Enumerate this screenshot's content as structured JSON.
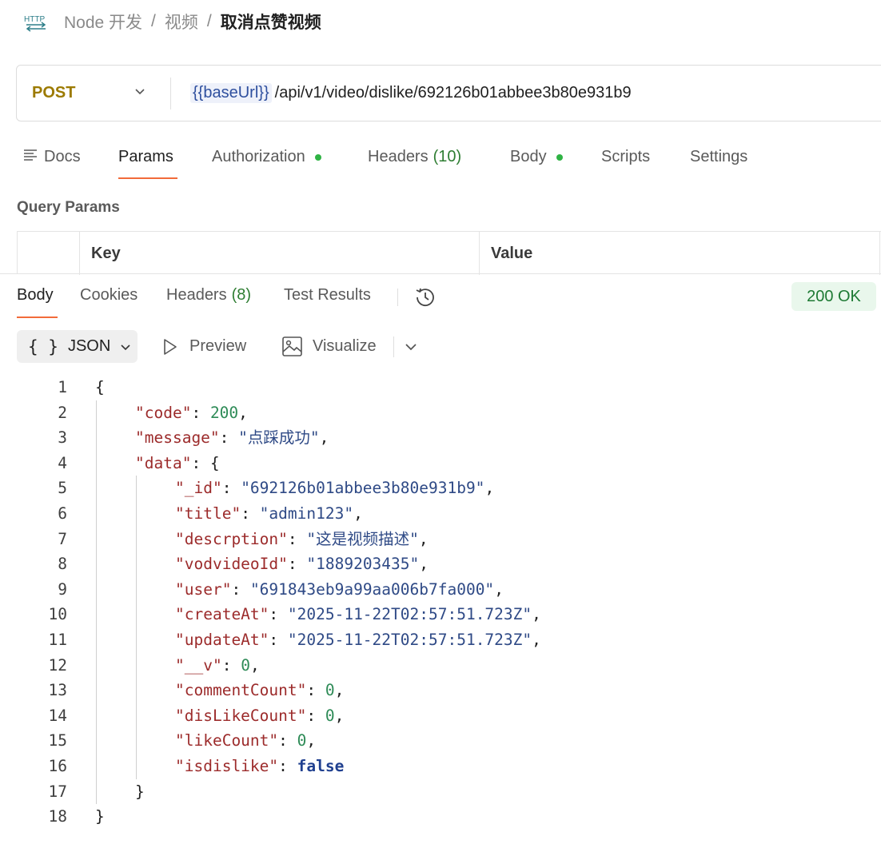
{
  "breadcrumb": {
    "icon": "http-icon",
    "icon_text": "HTTP",
    "items": [
      "Node 开发",
      "视频"
    ],
    "current": "取消点赞视频"
  },
  "request": {
    "method": "POST",
    "url_variable": "{{baseUrl}}",
    "url_path": "/api/v1/video/dislike/692126b01abbee3b80e931b9"
  },
  "request_tabs": {
    "docs": "Docs",
    "params": "Params",
    "authorization": "Authorization",
    "headers": "Headers",
    "headers_count": "(10)",
    "body": "Body",
    "scripts": "Scripts",
    "settings": "Settings"
  },
  "query_params": {
    "title": "Query Params",
    "columns": [
      "Key",
      "Value"
    ]
  },
  "response_tabs": {
    "body": "Body",
    "cookies": "Cookies",
    "headers": "Headers",
    "headers_count": "(8)",
    "test_results": "Test Results"
  },
  "status": "200 OK",
  "format": {
    "selected": "JSON",
    "preview": "Preview",
    "visualize": "Visualize"
  },
  "code_lines": [
    {
      "n": "1",
      "indent": 0,
      "parts": [
        [
          "p",
          "{"
        ]
      ]
    },
    {
      "n": "2",
      "indent": 1,
      "parts": [
        [
          "k",
          "\"code\""
        ],
        [
          "p",
          ": "
        ],
        [
          "n",
          "200"
        ],
        [
          "p",
          ","
        ]
      ]
    },
    {
      "n": "3",
      "indent": 1,
      "parts": [
        [
          "k",
          "\"message\""
        ],
        [
          "p",
          ": "
        ],
        [
          "s",
          "\"点踩成功\""
        ],
        [
          "p",
          ","
        ]
      ]
    },
    {
      "n": "4",
      "indent": 1,
      "parts": [
        [
          "k",
          "\"data\""
        ],
        [
          "p",
          ": {"
        ]
      ]
    },
    {
      "n": "5",
      "indent": 2,
      "parts": [
        [
          "k",
          "\"_id\""
        ],
        [
          "p",
          ": "
        ],
        [
          "s",
          "\"692126b01abbee3b80e931b9\""
        ],
        [
          "p",
          ","
        ]
      ]
    },
    {
      "n": "6",
      "indent": 2,
      "parts": [
        [
          "k",
          "\"title\""
        ],
        [
          "p",
          ": "
        ],
        [
          "s",
          "\"admin123\""
        ],
        [
          "p",
          ","
        ]
      ]
    },
    {
      "n": "7",
      "indent": 2,
      "parts": [
        [
          "k",
          "\"descrption\""
        ],
        [
          "p",
          ": "
        ],
        [
          "s",
          "\"这是视频描述\""
        ],
        [
          "p",
          ","
        ]
      ]
    },
    {
      "n": "8",
      "indent": 2,
      "parts": [
        [
          "k",
          "\"vodvideoId\""
        ],
        [
          "p",
          ": "
        ],
        [
          "s",
          "\"1889203435\""
        ],
        [
          "p",
          ","
        ]
      ]
    },
    {
      "n": "9",
      "indent": 2,
      "parts": [
        [
          "k",
          "\"user\""
        ],
        [
          "p",
          ": "
        ],
        [
          "s",
          "\"691843eb9a99aa006b7fa000\""
        ],
        [
          "p",
          ","
        ]
      ]
    },
    {
      "n": "10",
      "indent": 2,
      "parts": [
        [
          "k",
          "\"createAt\""
        ],
        [
          "p",
          ": "
        ],
        [
          "s",
          "\"2025-11-22T02:57:51.723Z\""
        ],
        [
          "p",
          ","
        ]
      ]
    },
    {
      "n": "11",
      "indent": 2,
      "parts": [
        [
          "k",
          "\"updateAt\""
        ],
        [
          "p",
          ": "
        ],
        [
          "s",
          "\"2025-11-22T02:57:51.723Z\""
        ],
        [
          "p",
          ","
        ]
      ]
    },
    {
      "n": "12",
      "indent": 2,
      "parts": [
        [
          "k",
          "\"__v\""
        ],
        [
          "p",
          ": "
        ],
        [
          "n",
          "0"
        ],
        [
          "p",
          ","
        ]
      ]
    },
    {
      "n": "13",
      "indent": 2,
      "parts": [
        [
          "k",
          "\"commentCount\""
        ],
        [
          "p",
          ": "
        ],
        [
          "n",
          "0"
        ],
        [
          "p",
          ","
        ]
      ]
    },
    {
      "n": "14",
      "indent": 2,
      "parts": [
        [
          "k",
          "\"disLikeCount\""
        ],
        [
          "p",
          ": "
        ],
        [
          "n",
          "0"
        ],
        [
          "p",
          ","
        ]
      ]
    },
    {
      "n": "15",
      "indent": 2,
      "parts": [
        [
          "k",
          "\"likeCount\""
        ],
        [
          "p",
          ": "
        ],
        [
          "n",
          "0"
        ],
        [
          "p",
          ","
        ]
      ]
    },
    {
      "n": "16",
      "indent": 2,
      "parts": [
        [
          "k",
          "\"isdislike\""
        ],
        [
          "p",
          ": "
        ],
        [
          "b",
          "false"
        ]
      ]
    },
    {
      "n": "17",
      "indent": 1,
      "parts": [
        [
          "p",
          "}"
        ]
      ]
    },
    {
      "n": "18",
      "indent": 0,
      "parts": [
        [
          "p",
          "}"
        ]
      ]
    }
  ],
  "colors": {
    "accent": "#f26b3a",
    "method": "#9c7a00",
    "status_bg": "#e9f7ec",
    "status_text": "#1e7a34",
    "json_key": "#9c2b2b",
    "json_string": "#2f4a86",
    "json_number": "#2e8b57"
  }
}
